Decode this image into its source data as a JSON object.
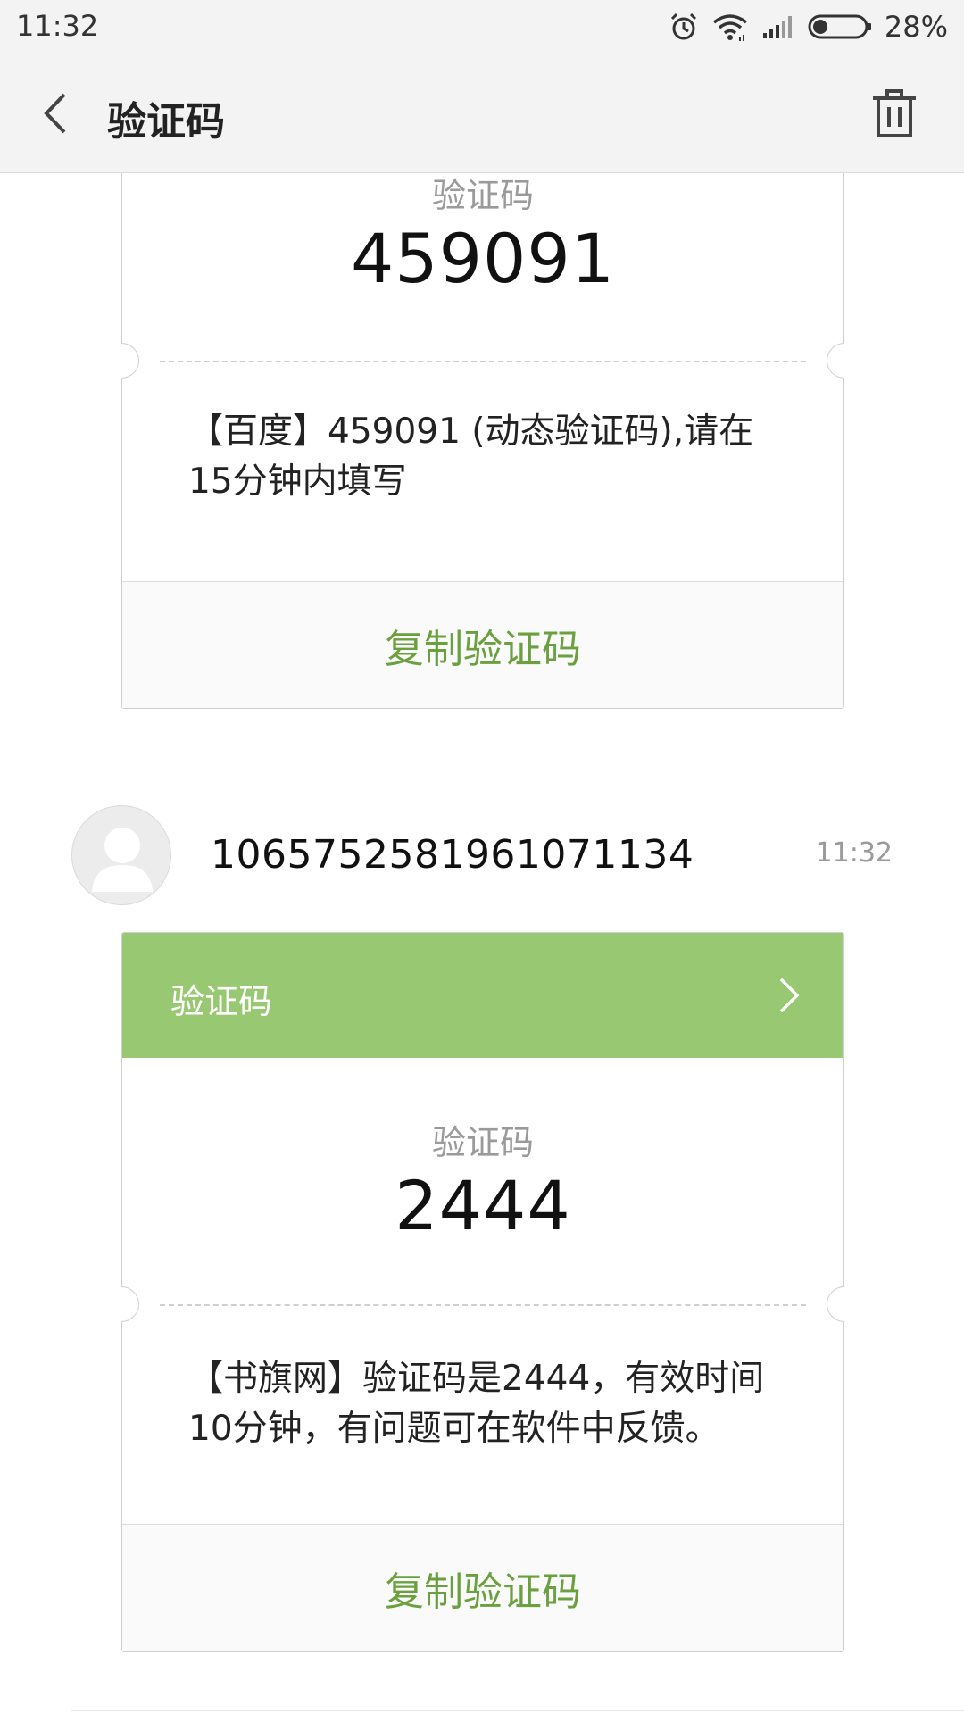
{
  "status_bar": {
    "time": "11:32",
    "battery": "28%",
    "icons": [
      "alarm-icon",
      "wifi-icon",
      "signal-icon",
      "battery-icon"
    ]
  },
  "header": {
    "title": "验证码",
    "back_icon": "chevron-left-icon",
    "delete_icon": "trash-icon"
  },
  "messages": [
    {
      "code_label": "验证码",
      "code": "459091",
      "body_line1": "【百度】459091 (动态验证码),请在",
      "body_line2": "15分钟内填写",
      "copy_label": "复制验证码"
    },
    {
      "sender": "1065752581961071134",
      "time": "11:32",
      "card_title": "验证码",
      "code_label": "验证码",
      "code": "2444",
      "body_line1": "【书旗网】验证码是2444，有效时间",
      "body_line2": "10分钟，有问题可在软件中反馈。",
      "copy_label": "复制验证码"
    }
  ],
  "colors": {
    "accent_green": "#98c872",
    "copy_text_green": "#6ba03f",
    "header_bg": "#f2f3f2"
  }
}
